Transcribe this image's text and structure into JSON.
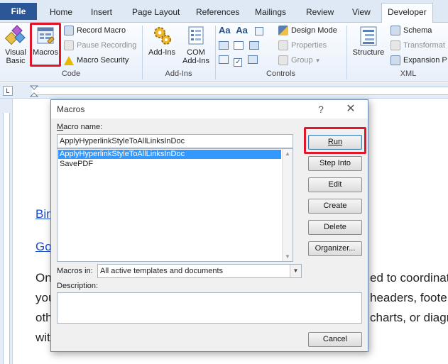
{
  "ribbon": {
    "tabs": [
      "File",
      "Home",
      "Insert",
      "Page Layout",
      "References",
      "Mailings",
      "Review",
      "View",
      "Developer"
    ],
    "code_group": {
      "label": "Code",
      "visual_basic": "Visual\nBasic",
      "macros": "Macros",
      "record_macro": "Record Macro",
      "pause_recording": "Pause Recording",
      "macro_security": "Macro Security"
    },
    "addins_group": {
      "label": "Add-Ins",
      "addins": "Add-Ins",
      "com_addins": "COM\nAdd-Ins"
    },
    "controls_group": {
      "label": "Controls",
      "design_mode": "Design Mode",
      "properties": "Properties",
      "group": "Group"
    },
    "xml_group": {
      "label": "XML",
      "structure": "Structure",
      "schema": "Schema",
      "transformation": "Transformat",
      "expansion_packs": "Expansion P"
    }
  },
  "document": {
    "link1": "Bin",
    "link2": "Go",
    "line1_left": "On",
    "line1_right": "ed to coordinat",
    "line2_left": "you",
    "line2_right": "headers, foote",
    "line3_left": "oth",
    "line3_right": "charts, or diagr",
    "line4_left": "wit"
  },
  "dialog": {
    "title": "Macros",
    "help": "?",
    "close": "✕",
    "macro_name_label": "Macro name:",
    "macro_name_value": "ApplyHyperlinkStyleToAllLinksInDoc",
    "macros": [
      "ApplyHyperlinkStyleToAllLinksInDoc",
      "SavePDF"
    ],
    "selected_index": 0,
    "macros_in_label": "Macros in:",
    "macros_in_value": "All active templates and documents",
    "description_label": "Description:",
    "buttons": {
      "run": "Run",
      "step_into": "Step Into",
      "edit": "Edit",
      "create": "Create",
      "delete": "Delete",
      "organizer": "Organizer...",
      "cancel": "Cancel"
    }
  },
  "colors": {
    "highlight": "#e0162b",
    "file_tab": "#2b5797",
    "selection": "#3399ff",
    "link": "#1a4ccc"
  }
}
